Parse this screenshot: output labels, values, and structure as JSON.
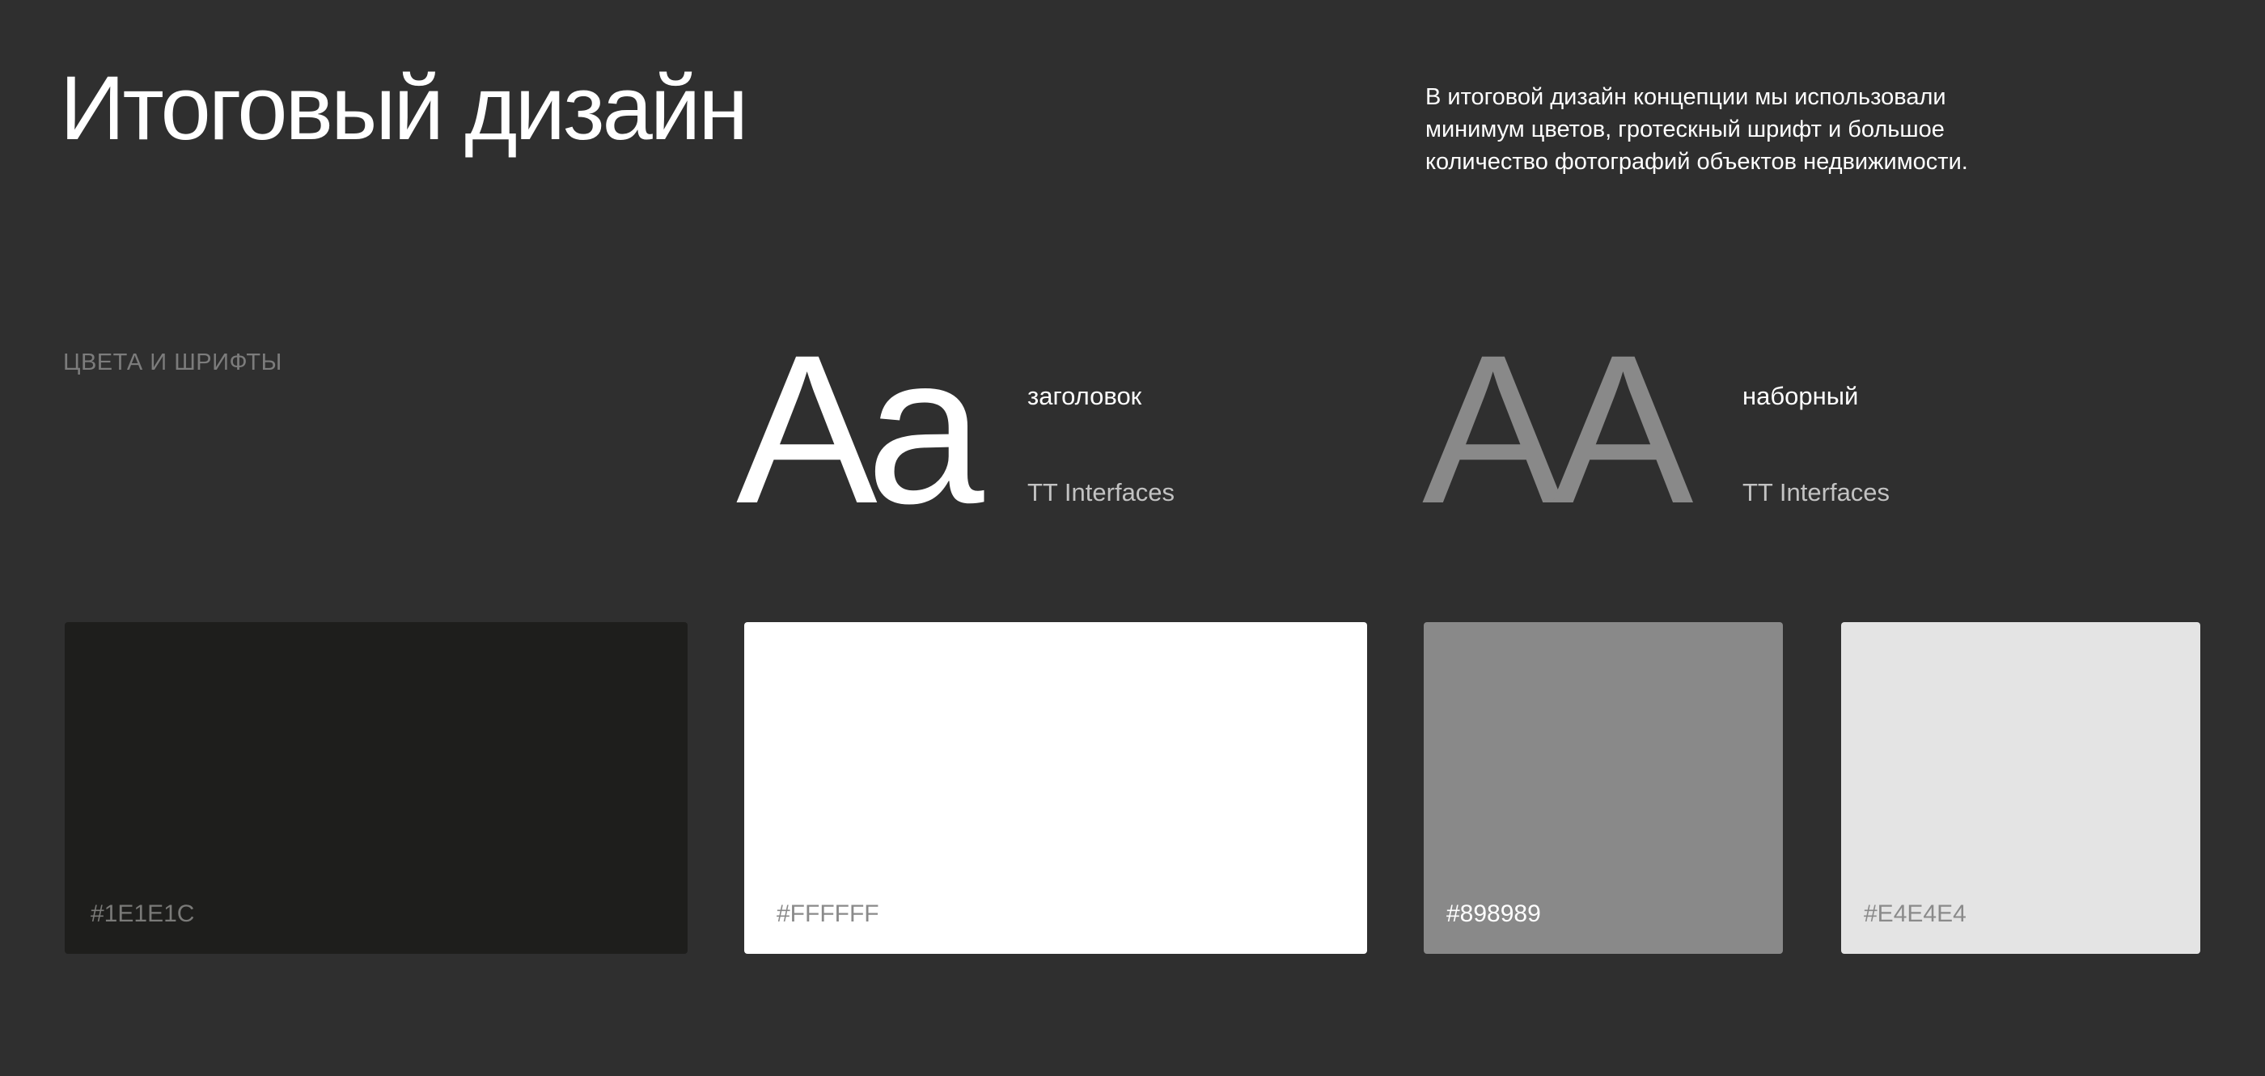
{
  "header": {
    "title": "Итоговый дизайн",
    "description_lines": [
      "В итоговой дизайн концепции мы использовали",
      "минимум цветов,  гротескный шрифт и большое",
      "количество фотографий объектов недвижимости."
    ]
  },
  "section_label": "ЦВЕТА И ШРИФТЫ",
  "fonts": [
    {
      "specimen": "Aa",
      "role": "заголовок",
      "name": "TT Interfaces",
      "color": "#FFFFFF"
    },
    {
      "specimen": "AA",
      "role": "наборный",
      "name": "TT Interfaces",
      "color": "#898989"
    }
  ],
  "palette": [
    {
      "hex": "#1E1E1C",
      "color": "#1E1E1C",
      "label_color": "#7A7A78"
    },
    {
      "hex": "#FFFFFF",
      "color": "#FFFFFF",
      "label_color": "#8A8A8A"
    },
    {
      "hex": "#898989",
      "color": "#898989",
      "label_color": "#FFFFFF"
    },
    {
      "hex": "#E4E4E4",
      "color": "#E4E4E4",
      "label_color": "#8A8A8A"
    }
  ]
}
